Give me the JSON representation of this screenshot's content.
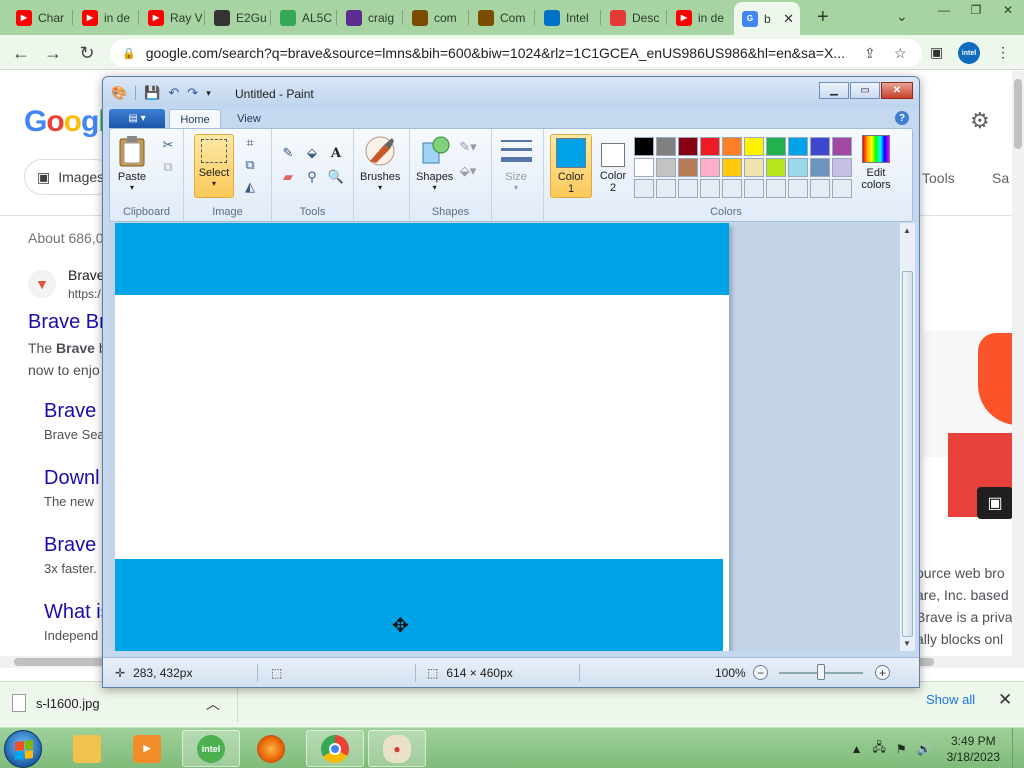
{
  "browser": {
    "tabs": [
      {
        "label": "Char",
        "icon": "youtube-icon",
        "color": "#ff0000"
      },
      {
        "label": "in de",
        "icon": "youtube-icon",
        "color": "#ff0000"
      },
      {
        "label": "Ray V",
        "icon": "youtube-icon",
        "color": "#ff0000"
      },
      {
        "label": "E2Gu",
        "icon": "globe-icon",
        "color": "#333333"
      },
      {
        "label": "AL5C",
        "icon": "pinwheel-icon",
        "color": "#34a853"
      },
      {
        "label": "craig",
        "icon": "peace-icon",
        "color": "#5c2d91"
      },
      {
        "label": "com",
        "icon": "store-icon",
        "color": "#7a4b00"
      },
      {
        "label": "Com",
        "icon": "store-icon",
        "color": "#7a4b00"
      },
      {
        "label": "Intel",
        "icon": "intel-icon",
        "color": "#0071c5"
      },
      {
        "label": "Desc",
        "icon": "swap-icon",
        "color": "#e53935"
      },
      {
        "label": "in de",
        "icon": "youtube-icon",
        "color": "#ff0000"
      },
      {
        "label": "b",
        "icon": "google-icon",
        "color": "#4285f4",
        "active": true
      }
    ],
    "url": "google.com/search?q=brave&source=lmns&bih=600&biw=1024&rlz=1C1GCEA_enUS986US986&hl=en&sa=X...",
    "colors": {
      "frame": "#a8d3a3",
      "toolbar": "#eef7ec"
    }
  },
  "google": {
    "images_chip": "Images",
    "tools": "Tools",
    "sa": "Sa",
    "about": "About 686,0",
    "result": {
      "site": "Brave",
      "url": "https:/",
      "title": "Brave Br",
      "snippet_prefix": "The ",
      "snippet_bold": "Brave",
      "snippet_suffix": " b",
      "snippet_line2": "now to enjo"
    },
    "sublinks": [
      {
        "title": "Brave S",
        "snippet": "Brave Sea"
      },
      {
        "title": "Downl",
        "snippet": "The new "
      },
      {
        "title": "Brave V",
        "snippet": "3x faster."
      },
      {
        "title": "What is",
        "snippet": "Independ"
      }
    ],
    "right_snippets": [
      "ource web bro",
      "are, Inc. based",
      "Brave is a priva",
      "ally blocks onl"
    ]
  },
  "paint": {
    "title": "Untitled - Paint",
    "tabs": {
      "home": "Home",
      "view": "View"
    },
    "groups": {
      "clipboard": "Clipboard",
      "image": "Image",
      "tools": "Tools",
      "shapes": "Shapes",
      "colors": "Colors"
    },
    "buttons": {
      "paste": "Paste",
      "select": "Select",
      "brushes": "Brushes",
      "shapes": "Shapes",
      "size": "Size",
      "color1_line1": "Color",
      "color1_line2": "1",
      "color2_line1": "Color",
      "color2_line2": "2",
      "edit_colors_line1": "Edit",
      "edit_colors_line2": "colors"
    },
    "color1": "#00a2e8",
    "color2": "#ffffff",
    "palette": [
      "#000000",
      "#7f7f7f",
      "#880015",
      "#ed1c24",
      "#ff7f27",
      "#fff200",
      "#22b14c",
      "#00a2e8",
      "#3f48cc",
      "#a349a4",
      "#ffffff",
      "#c3c3c3",
      "#b97a57",
      "#ffaec9",
      "#ffc90e",
      "#efe4b0",
      "#b5e61d",
      "#99d9ea",
      "#7092be",
      "#c8bfe7",
      "#e6ecf4",
      "#e6ecf4",
      "#e6ecf4",
      "#e6ecf4",
      "#e6ecf4",
      "#e6ecf4",
      "#e6ecf4",
      "#e6ecf4",
      "#e6ecf4",
      "#e6ecf4"
    ],
    "status": {
      "cursor_pos": "283, 432px",
      "canvas_size": "614 × 460px",
      "zoom": "100%"
    }
  },
  "downloads": {
    "file": "s-l1600.jpg",
    "show_all": "Show all"
  },
  "taskbar": {
    "time": "3:49 PM",
    "date": "3/18/2023"
  }
}
